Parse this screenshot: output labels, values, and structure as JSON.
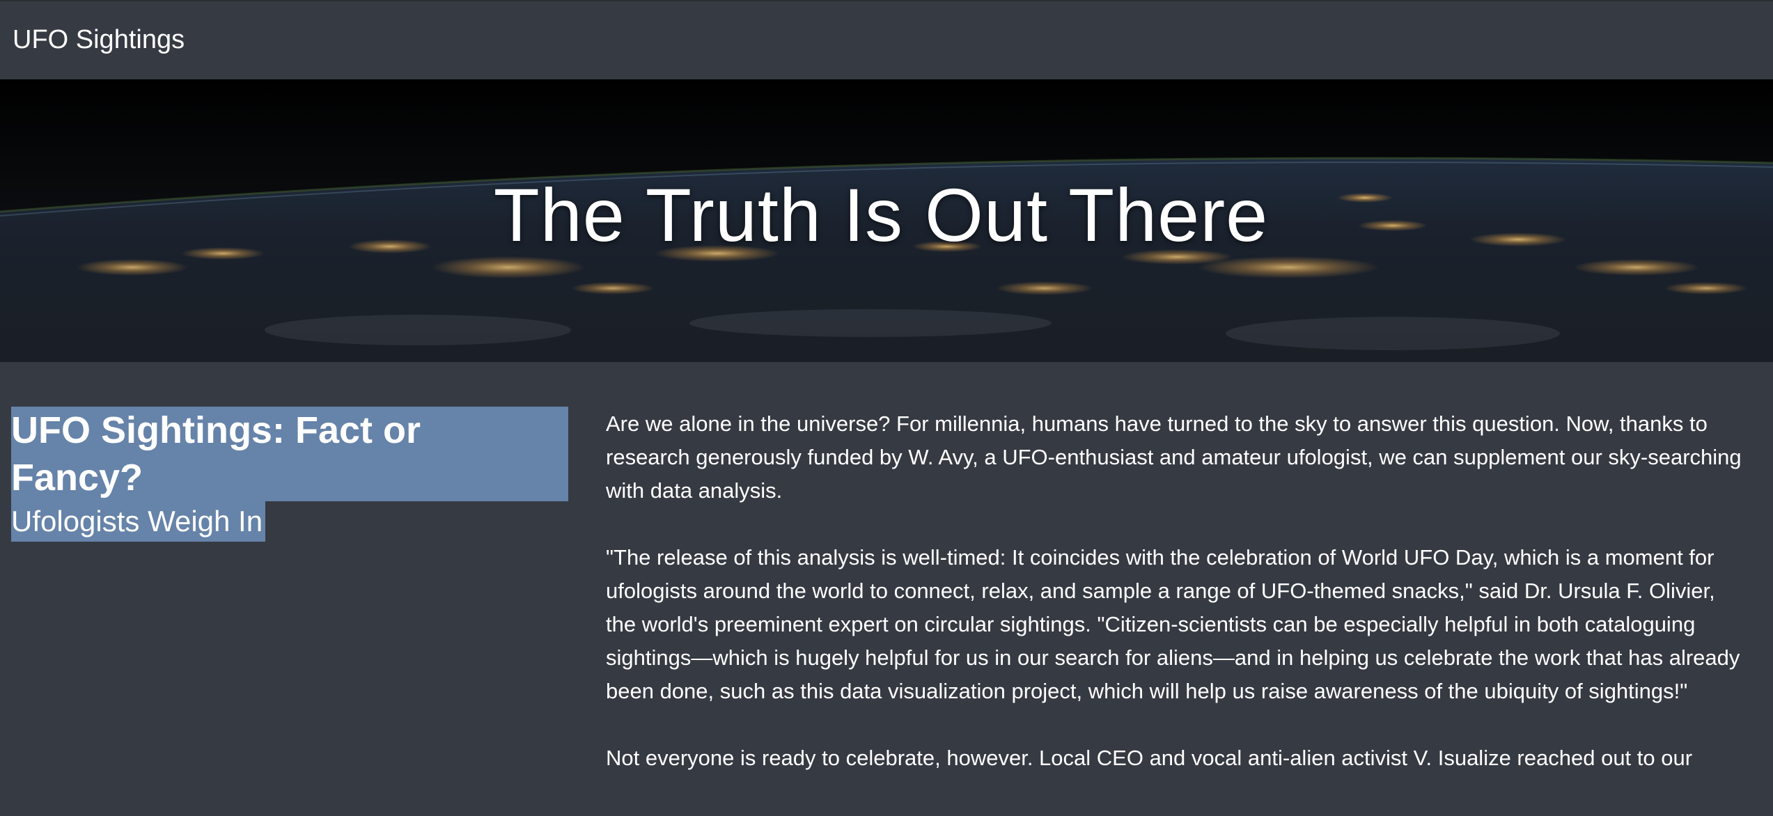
{
  "navbar": {
    "brand": "UFO Sightings"
  },
  "hero": {
    "title": "The Truth Is Out There"
  },
  "sidebar": {
    "headline": "UFO Sightings: Fact or Fancy?",
    "subheadline": "Ufologists Weigh In"
  },
  "article": {
    "paragraphs": [
      "Are we alone in the universe? For millennia, humans have turned to the sky to answer this question. Now, thanks to research generously funded by W. Avy, a UFO-enthusiast and amateur ufologist, we can supplement our sky-searching with data analysis.",
      "\"The release of this analysis is well-timed: It coincides with the celebration of World UFO Day, which is a moment for ufologists around the world to connect, relax, and sample a range of UFO-themed snacks,\" said Dr. Ursula F. Olivier, the world's preeminent expert on circular sightings. \"Citizen-scientists can be especially helpful in both cataloguing sightings—which is hugely helpful for us in our search for aliens—and in helping us celebrate the work that has already been done, such as this data visualization project, which will help us raise awareness of the ubiquity of sightings!\"",
      "Not everyone is ready to celebrate, however. Local CEO and vocal anti-alien activist V. Isualize reached out to our"
    ]
  },
  "colors": {
    "page_background": "#363a42",
    "selection_highlight": "#6683a9",
    "text": "#ffffff"
  }
}
